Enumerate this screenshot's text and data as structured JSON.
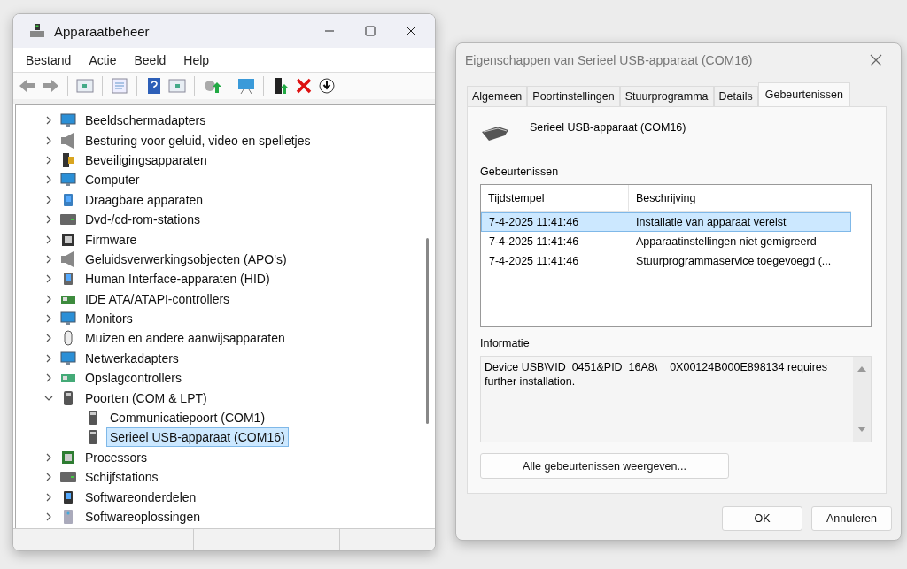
{
  "main_window": {
    "title": "Apparaatbeheer",
    "menu": [
      "Bestand",
      "Actie",
      "Beeld",
      "Help"
    ],
    "tree": [
      {
        "label": "Beeldschermadapters",
        "kind": "monitor",
        "expanded": false,
        "selected": false
      },
      {
        "label": "Besturing voor geluid, video en spelletjes",
        "kind": "speaker",
        "expanded": false,
        "selected": false
      },
      {
        "label": "Beveiligingsapparaten",
        "kind": "security",
        "expanded": false,
        "selected": false
      },
      {
        "label": "Computer",
        "kind": "monitor",
        "expanded": false,
        "selected": false
      },
      {
        "label": "Draagbare apparaten",
        "kind": "portable",
        "expanded": false,
        "selected": false
      },
      {
        "label": "Dvd-/cd-rom-stations",
        "kind": "drive",
        "expanded": false,
        "selected": false
      },
      {
        "label": "Firmware",
        "kind": "chip",
        "expanded": false,
        "selected": false
      },
      {
        "label": "Geluidsverwerkingsobjecten (APO's)",
        "kind": "speaker",
        "expanded": false,
        "selected": false
      },
      {
        "label": "Human Interface-apparaten (HID)",
        "kind": "hid",
        "expanded": false,
        "selected": false
      },
      {
        "label": "IDE ATA/ATAPI-controllers",
        "kind": "card",
        "expanded": false,
        "selected": false
      },
      {
        "label": "Monitors",
        "kind": "monitor",
        "expanded": false,
        "selected": false
      },
      {
        "label": "Muizen en andere aanwijsapparaten",
        "kind": "mouse",
        "expanded": false,
        "selected": false
      },
      {
        "label": "Netwerkadapters",
        "kind": "network",
        "expanded": false,
        "selected": false
      },
      {
        "label": "Opslagcontrollers",
        "kind": "storage",
        "expanded": false,
        "selected": false
      },
      {
        "label": "Poorten (COM & LPT)",
        "kind": "port",
        "expanded": true,
        "selected": false,
        "children": [
          {
            "label": "Communicatiepoort (COM1)",
            "kind": "port",
            "selected": false
          },
          {
            "label": "Serieel USB-apparaat (COM16)",
            "kind": "port",
            "selected": true
          }
        ]
      },
      {
        "label": "Processors",
        "kind": "cpu",
        "expanded": false,
        "selected": false
      },
      {
        "label": "Schijfstations",
        "kind": "drive",
        "expanded": false,
        "selected": false
      },
      {
        "label": "Softwareonderdelen",
        "kind": "software",
        "expanded": false,
        "selected": false
      },
      {
        "label": "Softwareoplossingen",
        "kind": "tower",
        "expanded": false,
        "selected": false
      }
    ]
  },
  "dialog": {
    "title": "Eigenschappen van Serieel USB-apparaat (COM16)",
    "tabs": [
      {
        "label": "Algemeen",
        "selected": false
      },
      {
        "label": "Poortinstellingen",
        "selected": false
      },
      {
        "label": "Stuurprogramma",
        "selected": false
      },
      {
        "label": "Details",
        "selected": false
      },
      {
        "label": "Gebeurtenissen",
        "selected": true
      }
    ],
    "device_name": "Serieel USB-apparaat (COM16)",
    "events_label": "Gebeurtenissen",
    "columns": [
      "Tijdstempel",
      "Beschrijving"
    ],
    "events": [
      {
        "time": "7-4-2025 11:41:46",
        "description": "Installatie van apparaat vereist",
        "selected": true
      },
      {
        "time": "7-4-2025 11:41:46",
        "description": "Apparaatinstellingen niet gemigreerd",
        "selected": false
      },
      {
        "time": "7-4-2025 11:41:46",
        "description": "Stuurprogrammaservice toegevoegd (...",
        "selected": false
      }
    ],
    "info_label": "Informatie",
    "info_text": "Device USB\\VID_0451&PID_16A8\\__0X00124B000E898134 requires further installation.",
    "show_all_button": "Alle gebeurtenissen weergeven...",
    "buttons": [
      "OK",
      "Annuleren"
    ]
  }
}
